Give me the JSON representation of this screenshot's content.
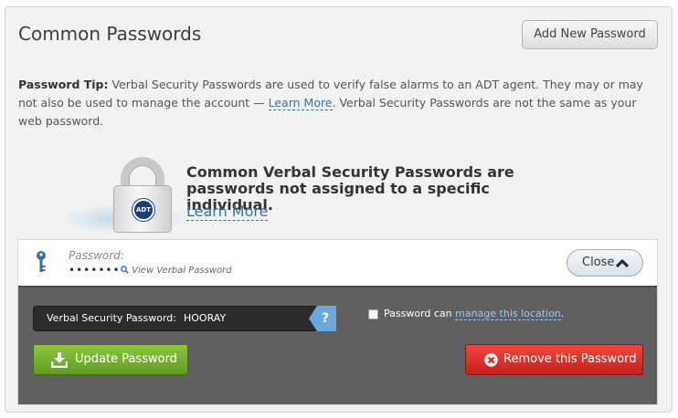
{
  "header": {
    "title": "Common Passwords",
    "add_button_label": "Add New Password"
  },
  "tip": {
    "label": "Password Tip:",
    "text_before_link": "Verbal Security Passwords are used to verify false alarms to an ADT agent. They may or may not also be used to manage the account — ",
    "link_label": "Learn More",
    "text_after_link": ". Verbal Security Passwords are not the same as your web password."
  },
  "promo": {
    "badge_text": "ADT",
    "heading": "Common Verbal Security Passwords are passwords not assigned to a specific individual.",
    "link_label": "Learn More"
  },
  "password_entry": {
    "label": "Password:",
    "masked_value": "•••••••",
    "view_link_label": "View Verbal Password",
    "close_label": "Close"
  },
  "edit_form": {
    "field_label": "Verbal Security Password:",
    "field_value": "HOORAY",
    "help_label": "?",
    "checkbox_checked": false,
    "checkbox_label": "Password can ",
    "checkbox_link_label": "manage this location",
    "checkbox_suffix": ".",
    "update_button_label": "Update Password",
    "remove_button_label": "Remove this Password"
  },
  "colors": {
    "update_button": "#6fae2b",
    "remove_button": "#e0332b",
    "link": "#3b6ea5",
    "help_badge": "#6aa7dc",
    "edit_panel_bg": "#606063"
  },
  "icons": {
    "lock": "lock-icon",
    "key": "key-icon",
    "search": "search-icon",
    "chevron": "chevron-up-icon",
    "download": "download-icon",
    "remove": "x-circle-icon"
  }
}
